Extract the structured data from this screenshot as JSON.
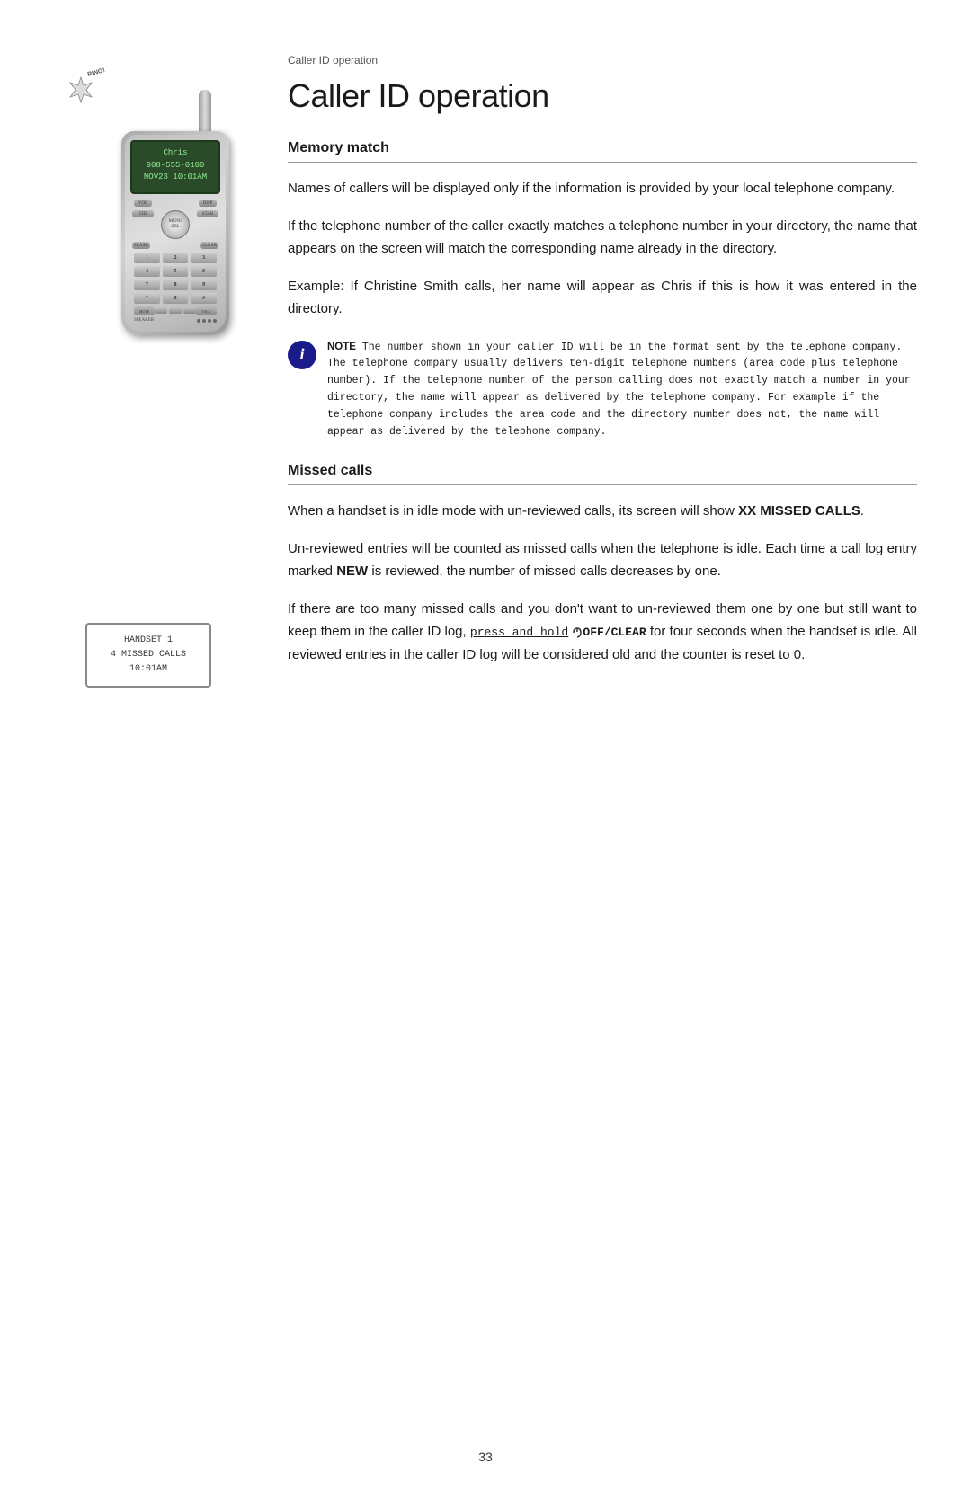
{
  "page": {
    "number": "33",
    "breadcrumb": "Caller ID operation",
    "title": "Caller ID operation"
  },
  "phone_display": {
    "name": "Chris",
    "number": "908-555-0100",
    "date_time": "NOV23  10:01AM"
  },
  "missed_calls_display": {
    "line1": "HANDSET 1",
    "line2": "4 MISSED CALLS",
    "line3": "10:01AM"
  },
  "sections": {
    "memory_match": {
      "heading": "Memory match",
      "para1": "Names of callers will be displayed only if the information is provided by your local telephone company.",
      "para2": "If the telephone number of the caller exactly matches a telephone number in your directory, the name that appears on the screen will match the corresponding name already in the directory.",
      "para3": "Example: If Christine Smith calls, her name will appear as Chris if this is how it was entered in the directory.",
      "note_label": "NOTE",
      "note_text": " The number shown in your caller ID will be in the format sent by the telephone company. The telephone company usually delivers ten-digit telephone numbers (area code plus telephone number). If the telephone number of the person calling does not exactly match a number in your directory, the name will appear as delivered by the telephone company. For example if the telephone company includes the area code and the directory number does not, the name will appear as delivered by the telephone company."
    },
    "missed_calls": {
      "heading": "Missed calls",
      "para1_prefix": "When a handset is in idle mode with un-reviewed calls, its screen will show ",
      "para1_bold": "XX MISSED CALLS",
      "para1_suffix": ".",
      "para2": "Un-reviewed entries will be counted as missed calls when the telephone is idle. Each time a call log entry marked NEW is reviewed, the number of missed calls decreases by one.",
      "para3_prefix": "If there are too many missed calls and you don't want to un-reviewed them one by one but still want to keep them in the caller ID log, ",
      "para3_underline": "press and hold",
      "para3_middle": " ",
      "para3_button": "OFF/CLEAR",
      "para3_suffix": " for four seconds when the handset is idle. All reviewed entries in the caller ID log will be considered old and the counter is reset to 0.",
      "new_bold": "NEW"
    }
  },
  "keypad": {
    "keys": [
      "1",
      "2",
      "3",
      "4",
      "5",
      "6",
      "7",
      "8",
      "9",
      "*",
      "0",
      "#"
    ]
  }
}
